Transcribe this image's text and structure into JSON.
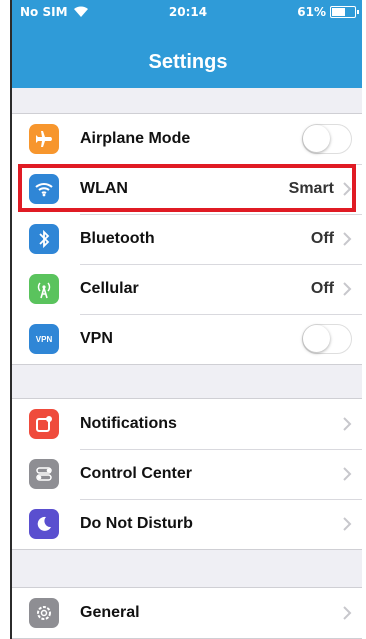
{
  "status_bar": {
    "carrier": "No SIM",
    "time": "20:14",
    "battery_text": "61%",
    "battery_level": 0.61
  },
  "nav": {
    "title": "Settings"
  },
  "groups": [
    {
      "rows": [
        {
          "label": "Airplane Mode",
          "icon": "airplane-icon",
          "icon_color": "#f7962d",
          "accessory": "toggle",
          "toggle_on": false
        },
        {
          "label": "WLAN",
          "icon": "wifi-icon",
          "icon_color": "#2f86d6",
          "accessory": "value",
          "value": "Smart"
        },
        {
          "label": "Bluetooth",
          "icon": "bluetooth-icon",
          "icon_color": "#2f86d6",
          "accessory": "value",
          "value": "Off"
        },
        {
          "label": "Cellular",
          "icon": "cellular-icon",
          "icon_color": "#5ac35d",
          "accessory": "value",
          "value": "Off"
        },
        {
          "label": "VPN",
          "icon": "vpn-icon",
          "icon_color": "#2f86d6",
          "icon_text": "VPN",
          "accessory": "toggle",
          "toggle_on": false
        }
      ]
    },
    {
      "rows": [
        {
          "label": "Notifications",
          "icon": "notifications-icon",
          "icon_color": "#ef4b3c",
          "accessory": "chevron"
        },
        {
          "label": "Control Center",
          "icon": "control-center-icon",
          "icon_color": "#8e8e93",
          "accessory": "chevron"
        },
        {
          "label": "Do Not Disturb",
          "icon": "moon-icon",
          "icon_color": "#5a4fcf",
          "accessory": "chevron"
        }
      ]
    },
    {
      "rows": [
        {
          "label": "General",
          "icon": "gear-icon",
          "icon_color": "#8e8e93",
          "accessory": "chevron"
        }
      ]
    }
  ],
  "colors": {
    "accent": "#2f9bd8",
    "highlight": "#e01b24"
  }
}
